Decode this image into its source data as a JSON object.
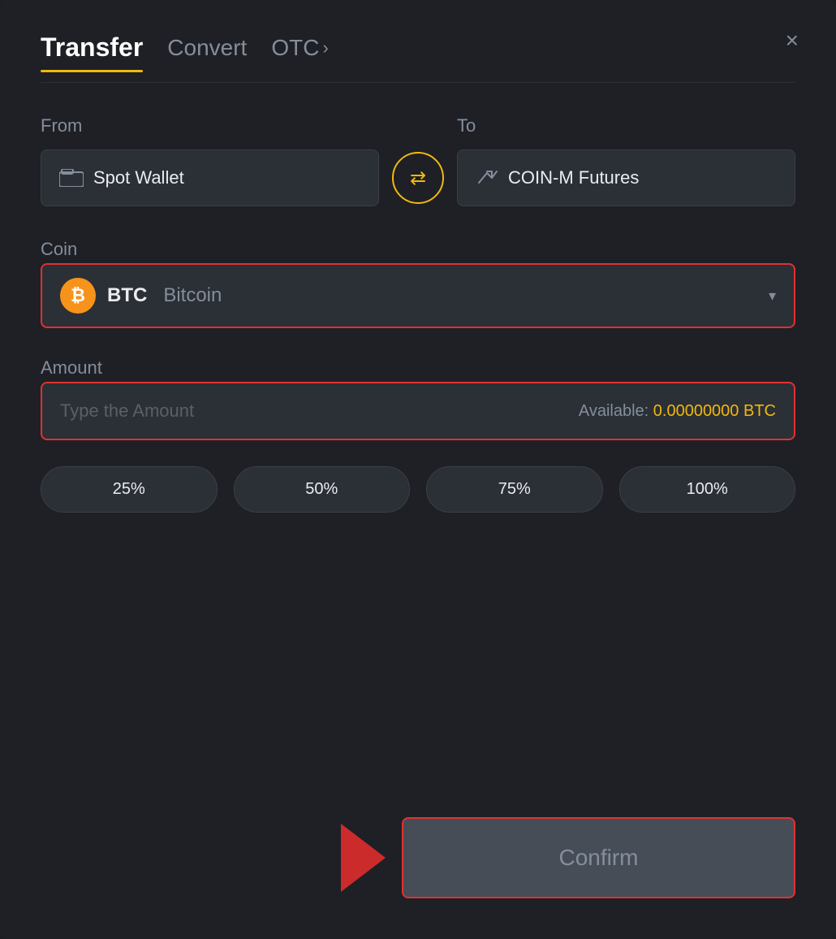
{
  "header": {
    "tab_transfer": "Transfer",
    "tab_convert": "Convert",
    "tab_otc": "OTC",
    "tab_otc_chevron": "›",
    "close_label": "×"
  },
  "from_to": {
    "from_label": "From",
    "to_label": "To",
    "from_wallet": "Spot Wallet",
    "to_wallet": "COIN-M Futures",
    "swap_icon": "⇄"
  },
  "coin": {
    "label": "Coin",
    "symbol": "BTC",
    "name": "Bitcoin",
    "chevron": "▾"
  },
  "amount": {
    "label": "Amount",
    "placeholder": "Type the Amount",
    "available_label": "Available:",
    "available_value": "0.00000000 BTC"
  },
  "percent_buttons": [
    {
      "label": "25%"
    },
    {
      "label": "50%"
    },
    {
      "label": "75%"
    },
    {
      "label": "100%"
    }
  ],
  "confirm": {
    "label": "Confirm"
  }
}
